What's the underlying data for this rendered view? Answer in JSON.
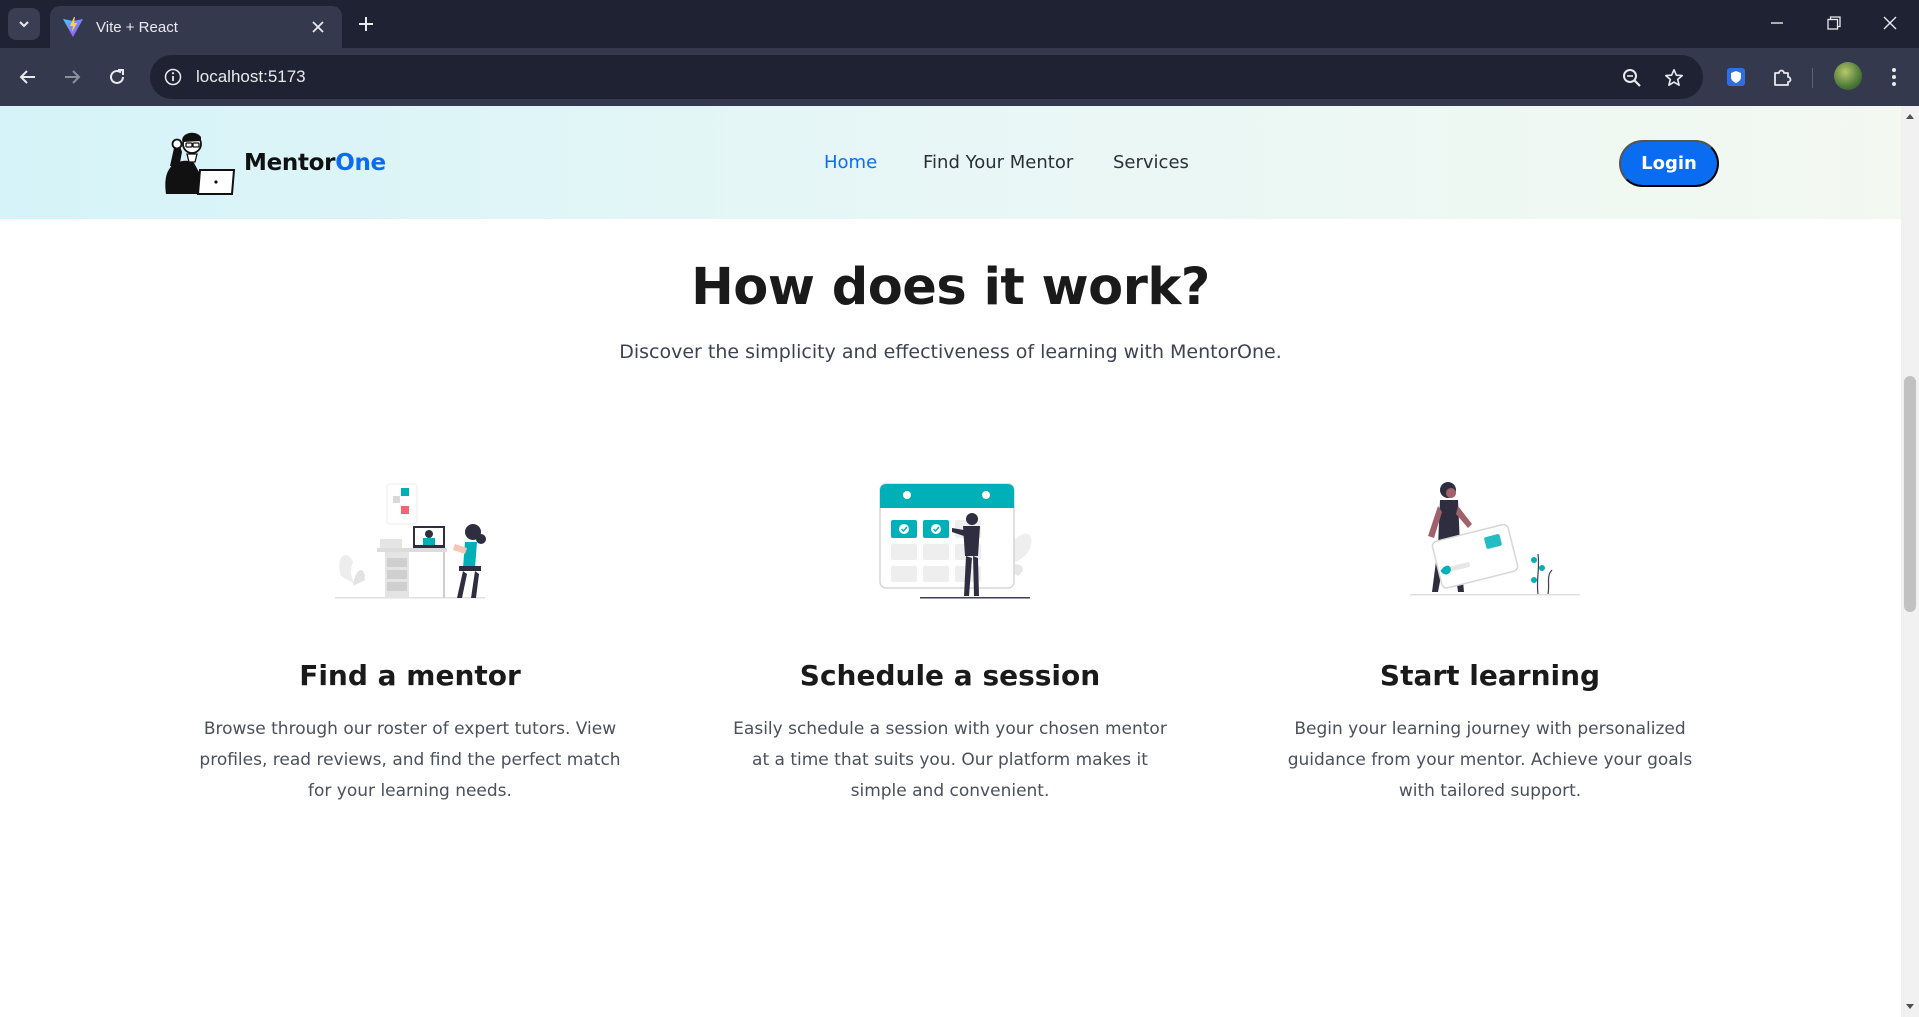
{
  "browser": {
    "tab_title": "Vite + React",
    "url": "localhost:5173"
  },
  "site": {
    "logo_main": "Mentor",
    "logo_accent": "One",
    "nav": {
      "home": "Home",
      "find_mentor": "Find Your Mentor",
      "services": "Services"
    },
    "login_label": "Login"
  },
  "section": {
    "title": "How does it work?",
    "subtitle": "Discover the simplicity and effectiveness of learning with MentorOne."
  },
  "steps": [
    {
      "title": "Find a mentor",
      "description": "Browse through our roster of expert tutors. View profiles, read reviews, and find the perfect match for your learning needs."
    },
    {
      "title": "Schedule a session",
      "description": "Easily schedule a session with your chosen mentor at a time that suits you. Our platform makes it simple and convenient."
    },
    {
      "title": "Start learning",
      "description": "Begin your learning journey with personalized guidance from your mentor. Achieve your goals with tailored support."
    }
  ],
  "colors": {
    "accent": "#0a6cf1",
    "teal": "#00b0b9",
    "chrome_dark": "#1f2233",
    "chrome_mid": "#35394e"
  },
  "icons": [
    "tab-list-icon",
    "vite-favicon-icon",
    "close-icon",
    "plus-icon",
    "minimize-icon",
    "restore-icon",
    "back-icon",
    "forward-icon",
    "reload-icon",
    "info-icon",
    "zoom-icon",
    "star-icon",
    "shield-extension-icon",
    "puzzle-icon",
    "kebab-menu-icon"
  ]
}
